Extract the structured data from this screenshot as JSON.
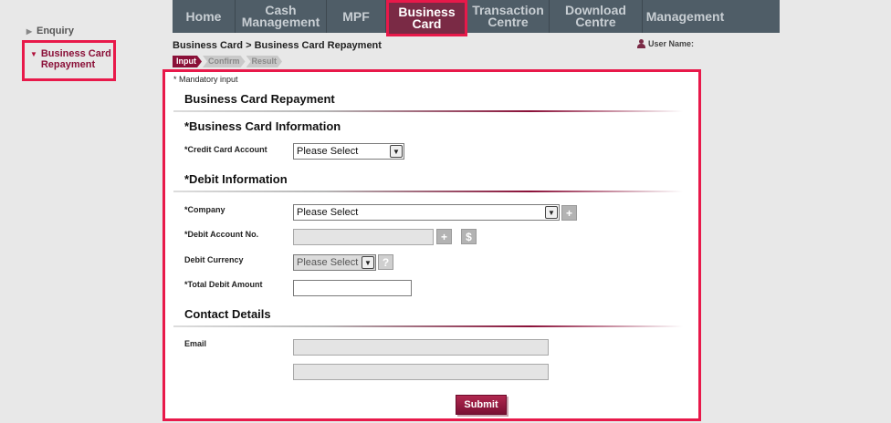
{
  "sidebar": {
    "items": [
      {
        "label": "Enquiry"
      },
      {
        "label": "Business Card Repayment"
      }
    ]
  },
  "nav": {
    "tabs": [
      {
        "label": "Home"
      },
      {
        "label": "Cash Management"
      },
      {
        "label": "MPF"
      },
      {
        "label": "Business Card"
      },
      {
        "label": "Transaction Centre"
      },
      {
        "label": "Download Centre"
      },
      {
        "label": "Management"
      }
    ],
    "active_tab": "Business Card"
  },
  "header": {
    "breadcrumb": "Business Card > Business Card Repayment",
    "user_label": "User Name:"
  },
  "steps": [
    "Input",
    "Confirm",
    "Result"
  ],
  "form": {
    "mandatory_note": "* Mandatory input",
    "title": "Business Card Repayment",
    "card_section": {
      "title": "*Business Card Information",
      "credit_card_label": "*Credit Card Account",
      "credit_card_value": "Please Select"
    },
    "debit_section": {
      "title": "*Debit Information",
      "company_label": "*Company",
      "company_value": "Please Select",
      "account_label": "*Debit Account No.",
      "currency_label": "Debit Currency",
      "currency_value": "Please Select",
      "amount_label": "*Total Debit Amount"
    },
    "contact_section": {
      "title": "Contact Details",
      "email_label": "Email"
    },
    "submit_label": "Submit"
  },
  "colors": {
    "brand": "#8a1038",
    "nav_bg": "#4f5d67",
    "highlight": "#e8194a"
  }
}
